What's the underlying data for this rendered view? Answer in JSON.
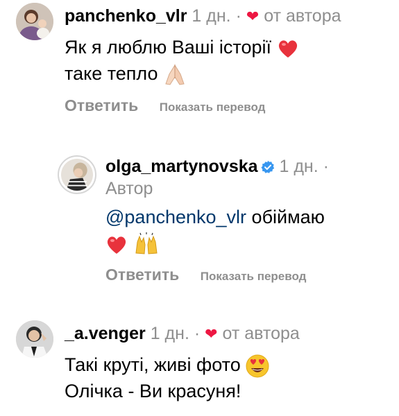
{
  "comments": [
    {
      "username": "panchenko_vlr",
      "time": "1 дн.",
      "separator": "·",
      "author_heart": "от автора",
      "line1": "Як я люблю Ваші історії",
      "line2": "таке тепло",
      "reply_label": "Ответить",
      "translate_label": "Показать перевод"
    },
    {
      "username": "olga_martynovska",
      "verified": true,
      "time": "1 дн.",
      "separator": "·",
      "role": "Автор",
      "mention": "@panchenko_vlr",
      "text": "обіймаю",
      "reply_label": "Ответить",
      "translate_label": "Показать перевод"
    },
    {
      "username": "_a.venger",
      "time": "1 дн.",
      "separator": "·",
      "author_heart": "от автора",
      "line1": "Такі круті, живі фото",
      "line2": "Олічка - Ви красуня!"
    }
  ],
  "colors": {
    "muted": "#8e8e8e",
    "heart": "#ed1742",
    "mention": "#00376b"
  }
}
